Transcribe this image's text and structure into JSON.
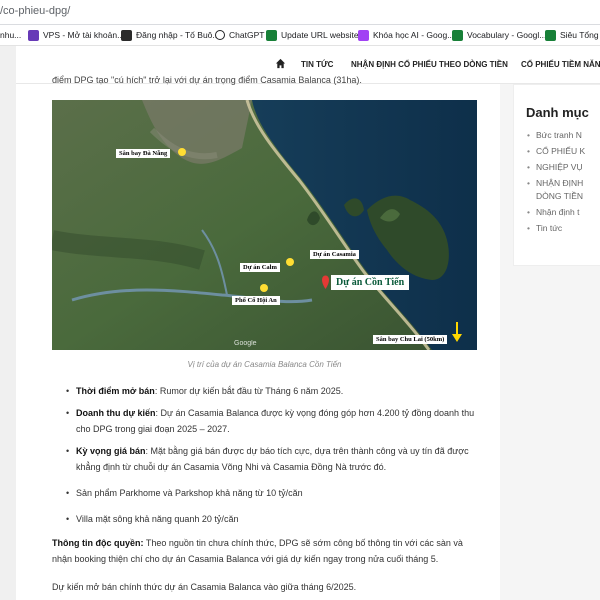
{
  "browser": {
    "url": "/co-phieu-dpg/",
    "bookmarks": [
      {
        "label": "nhu...",
        "color": "#f9a825"
      },
      {
        "label": "VPS - Mở tài khoản...",
        "color": "#673ab7"
      },
      {
        "label": "Đăng nhập - Tố Buô...",
        "color": "#e91e63"
      },
      {
        "label": "ChatGPT",
        "color": "#202124"
      },
      {
        "label": "Update URL website...",
        "color": "#188038"
      },
      {
        "label": "Khóa học AI - Goog...",
        "color": "#a142f4"
      },
      {
        "label": "Vocabulary - Googl...",
        "color": "#188038"
      },
      {
        "label": "Siêu Tổng Ho",
        "color": "#188038"
      }
    ]
  },
  "nav": {
    "items": [
      "TIN TỨC",
      "NHẬN ĐỊNH CỔ PHIẾU THEO DÒNG TIỀN",
      "CỔ PHIẾU TIỀM NĂNG"
    ]
  },
  "article": {
    "intro": "điểm DPG tạo \"cú hích\" trở lại với dự án trọng điểm Casamia Balanca (31ha).",
    "map_labels": {
      "airport_danang": "Sân bay Đà Nẵng",
      "casamia": "Dự án Casamia",
      "calm": "Dự án Calm",
      "con_tien": "Dự án Cồn Tiến",
      "hoian": "Phố Cổ Hội An",
      "chulai": "Sân bay Chu Lai (50km)",
      "google": "Google"
    },
    "caption": "Vị trí của dự án Casamia Balanca Cồn Tiến",
    "bullets": [
      {
        "label": "Thời điểm mở bán",
        "text": ": Rumor dự kiến bắt đầu từ Tháng 6 năm 2025."
      },
      {
        "label": "Doanh thu dự kiến",
        "text": ": Dự án Casamia Balanca được kỳ vọng đóng góp hơn 4.200 tỷ đồng doanh thu cho DPG trong giai đoạn 2025 – 2027."
      },
      {
        "label": "Kỳ vọng giá bán",
        "text": ": Mặt bằng giá bán được dự báo tích cực, dựa trên thành công và uy tín đã được khẳng định từ chuỗi dự án Casamia Võng Nhi và Casamia Đồng Nà trước đó."
      },
      {
        "label": "",
        "text": "Sản phẩm Parkhome và Parkshop khả năng từ 10 tỷ/căn"
      },
      {
        "label": "",
        "text": "Villa mặt sông khả năng quanh 20 tỷ/căn"
      }
    ],
    "exclusive_label": "Thông tin độc quyền:",
    "exclusive_text": " Theo nguồn tin chưa chính thức, DPG sẽ sớm công bố thông tin với các sàn và nhận booking thiện chí cho dự án Casamia Balanca với giá dự kiến ngay trong nửa cuối tháng 5.",
    "closing": "Dự kiến mở bán chính thức dự án Casamia Balanca vào giữa tháng 6/2025."
  },
  "sidebar": {
    "heading": "Danh mục",
    "items": [
      "Bức tranh N",
      "CỔ PHIẾU K",
      "NGHIỆP VỤ",
      "NHẬN ĐỊNH",
      "DÒNG TIỀN",
      "Nhận định t",
      "Tin tức"
    ]
  }
}
